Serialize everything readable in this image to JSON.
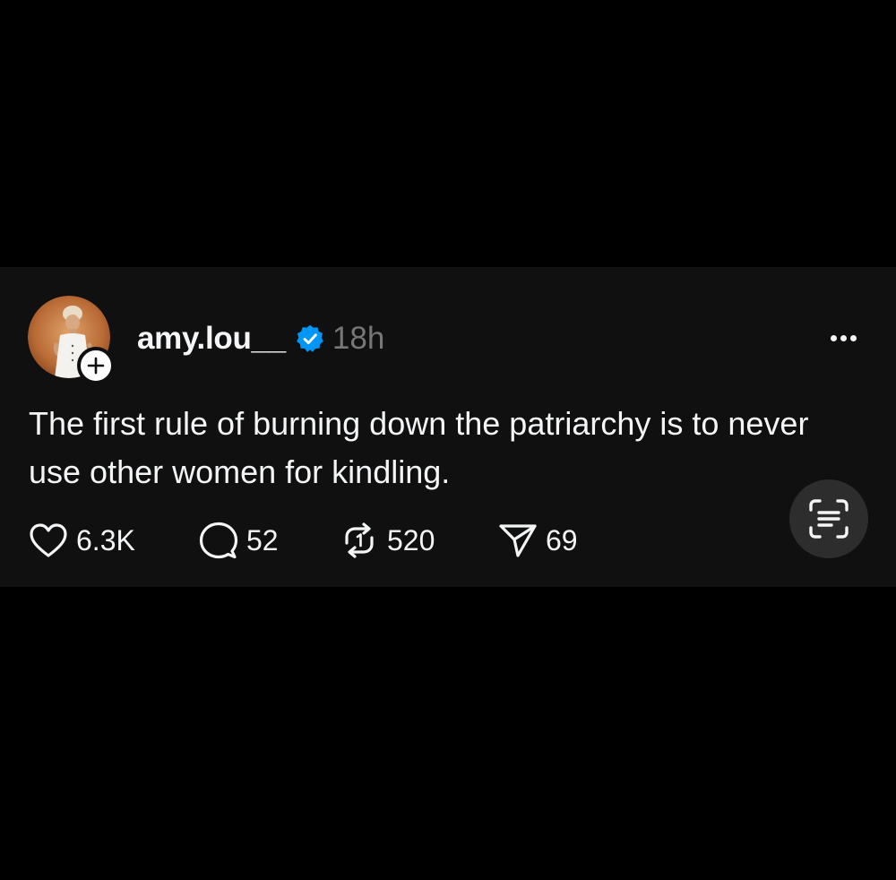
{
  "post": {
    "author": {
      "username": "amy.lou__",
      "verified": true,
      "avatar_icon": "profile-photo",
      "follow_badge_icon": "plus-icon"
    },
    "timestamp": "18h",
    "text": "The first rule of burning down the patriarchy is to never use other women for kindling.",
    "actions": {
      "likes": "6.3K",
      "replies": "52",
      "reposts": "520",
      "shares": "69"
    },
    "icons": {
      "like": "heart-icon",
      "reply": "speech-bubble-icon",
      "repost": "repost-arrows-icon",
      "share": "paper-plane-icon",
      "more": "ellipsis-icon",
      "scan": "text-scan-icon"
    }
  },
  "colors": {
    "page_background": "#000000",
    "card_background": "#101010",
    "text_primary": "#f3f5f7",
    "text_secondary": "#777777",
    "verified_blue": "#0095f6",
    "scan_button": "#2d2d2d"
  }
}
